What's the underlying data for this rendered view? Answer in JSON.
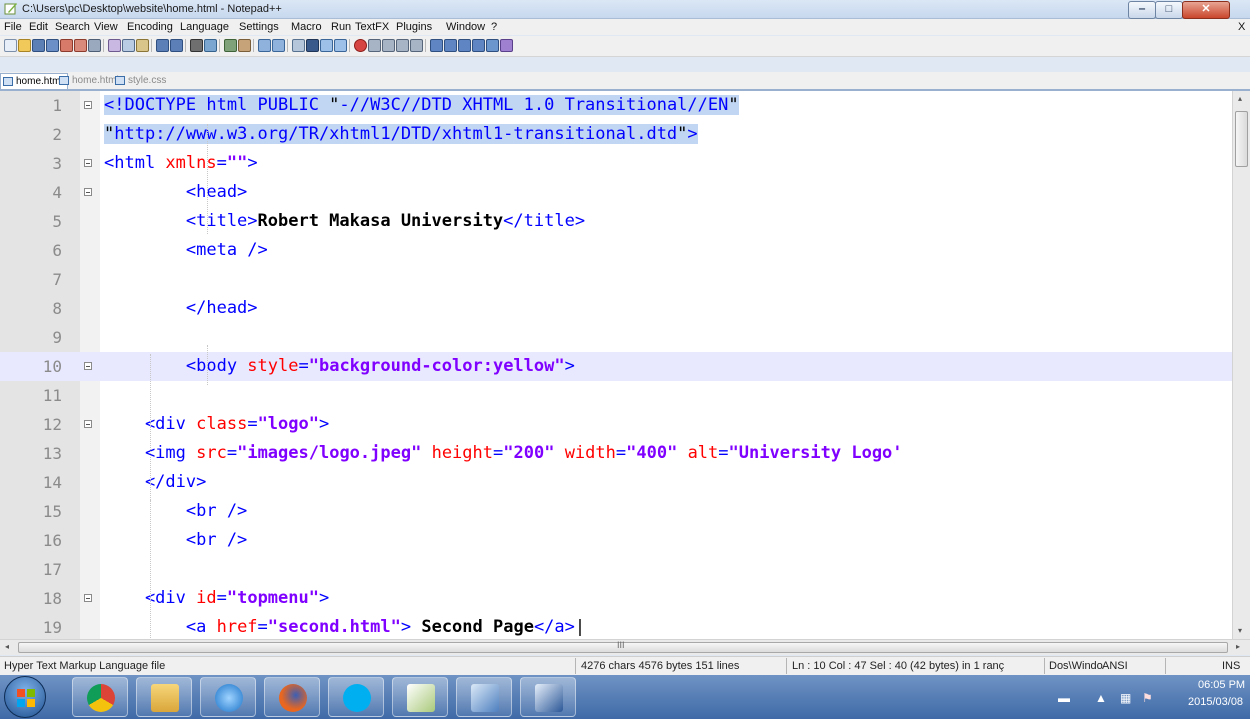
{
  "window": {
    "title": "C:\\Users\\pc\\Desktop\\website\\home.html - Notepad++",
    "minimize_glyph": "‒",
    "maximize_glyph": "□",
    "close_glyph": "✕"
  },
  "menubar": {
    "items": [
      "File",
      "Edit",
      "Search",
      "View",
      "Encoding",
      "Language",
      "Settings",
      "Macro",
      "Run",
      "TextFX",
      "Plugins",
      "Window",
      "?"
    ],
    "close_label": "X"
  },
  "tabs": [
    {
      "label": "home.html",
      "active": true
    },
    {
      "label": "home.html",
      "active": false
    },
    {
      "label": "style.css",
      "active": false
    }
  ],
  "editor": {
    "lines": [
      {
        "n": "1",
        "segs": [
          [
            "tag",
            "<!DOCTYPE html PUBLIC "
          ],
          [
            "plain",
            "\""
          ],
          [
            "tag",
            "-//W3C//DTD XHTML 1.0 Transitional//EN"
          ],
          [
            "plain",
            "\""
          ]
        ]
      },
      {
        "n": "2",
        "segs": [
          [
            "plain",
            "\""
          ],
          [
            "tag",
            "http://www.w3.org/TR/xhtml1/DTD/xhtml1-transitional.dtd"
          ],
          [
            "plain",
            "\""
          ],
          [
            "tag",
            ">"
          ]
        ]
      },
      {
        "n": "3",
        "segs": [
          [
            "tag",
            "<html "
          ],
          [
            "attr",
            "xmlns"
          ],
          [
            "tag",
            "="
          ],
          [
            "str",
            "\"\""
          ],
          [
            "tag",
            ">"
          ]
        ]
      },
      {
        "n": "4",
        "segs": [
          [
            "tag",
            "        <head>"
          ]
        ]
      },
      {
        "n": "5",
        "segs": [
          [
            "tag",
            "        <title>"
          ],
          [
            "txt",
            "Robert Makasa University"
          ],
          [
            "tag",
            "</title>"
          ]
        ]
      },
      {
        "n": "6",
        "segs": [
          [
            "tag",
            "        <meta />"
          ]
        ]
      },
      {
        "n": "7",
        "segs": []
      },
      {
        "n": "8",
        "segs": [
          [
            "tag",
            "        </head>"
          ]
        ]
      },
      {
        "n": "9",
        "segs": []
      },
      {
        "n": "10",
        "segs": [
          [
            "tag",
            "        <body "
          ],
          [
            "attr",
            "style"
          ],
          [
            "tag",
            "="
          ],
          [
            "str",
            "\"background-color:yellow\""
          ],
          [
            "tag",
            ">"
          ]
        ]
      },
      {
        "n": "11",
        "segs": []
      },
      {
        "n": "12",
        "segs": [
          [
            "tag",
            "    <div "
          ],
          [
            "attr",
            "class"
          ],
          [
            "tag",
            "="
          ],
          [
            "str",
            "\"logo\""
          ],
          [
            "tag",
            ">"
          ]
        ]
      },
      {
        "n": "13",
        "segs": [
          [
            "tag",
            "    <img "
          ],
          [
            "attr",
            "src"
          ],
          [
            "tag",
            "="
          ],
          [
            "str",
            "\"images/logo.jpeg\""
          ],
          [
            "tag",
            " "
          ],
          [
            "attr",
            "height"
          ],
          [
            "tag",
            "="
          ],
          [
            "str",
            "\"200\""
          ],
          [
            "tag",
            " "
          ],
          [
            "attr",
            "width"
          ],
          [
            "tag",
            "="
          ],
          [
            "str",
            "\"400\""
          ],
          [
            "tag",
            " "
          ],
          [
            "attr",
            "alt"
          ],
          [
            "tag",
            "="
          ],
          [
            "str",
            "\"University Logo'"
          ]
        ]
      },
      {
        "n": "14",
        "segs": [
          [
            "tag",
            "    </div>"
          ]
        ]
      },
      {
        "n": "15",
        "segs": [
          [
            "tag",
            "        <br />"
          ]
        ]
      },
      {
        "n": "16",
        "segs": [
          [
            "tag",
            "        <br />"
          ]
        ]
      },
      {
        "n": "17",
        "segs": []
      },
      {
        "n": "18",
        "segs": [
          [
            "tag",
            "    <div "
          ],
          [
            "attr",
            "id"
          ],
          [
            "tag",
            "="
          ],
          [
            "str",
            "\"topmenu\""
          ],
          [
            "tag",
            ">"
          ]
        ]
      },
      {
        "n": "19",
        "segs": [
          [
            "tag",
            "        <a "
          ],
          [
            "attr",
            "href"
          ],
          [
            "tag",
            "="
          ],
          [
            "str",
            "\"second.html\""
          ],
          [
            "tag",
            "> "
          ],
          [
            "txt",
            "Second Page"
          ],
          [
            "tag",
            "</a>"
          ],
          [
            "plain",
            "|"
          ]
        ]
      }
    ]
  },
  "scrollbar": {
    "h_grip": "III",
    "left_arrow": "◂",
    "right_arrow": "▸",
    "up_arrow": "▴",
    "down_arrow": "▾"
  },
  "statusbar": {
    "file_type": "Hyper Text Markup Language file",
    "counts": "4276 chars  4576 bytes  151 lines",
    "position": "Ln : 10   Col : 47   Sel : 40 (42 bytes) in 1 ranç",
    "eol": "Dos\\Windo",
    "encoding": "ANSI",
    "mode": "INS"
  },
  "taskbar": {
    "apps": [
      "start-button",
      "chrome",
      "file-explorer",
      "internet-explorer",
      "firefox",
      "skype",
      "notepad-plus-plus",
      "clipboard",
      "word"
    ],
    "tray_time": "06:05 PM",
    "tray_date": "2015/03/08"
  },
  "colors": {
    "tag": "#0000ff",
    "attr": "#ff0000",
    "string": "#8000ff",
    "selection": "#c0d6f2",
    "caret_line": "#e8e8ff",
    "taskbar": "#4f78b2"
  }
}
